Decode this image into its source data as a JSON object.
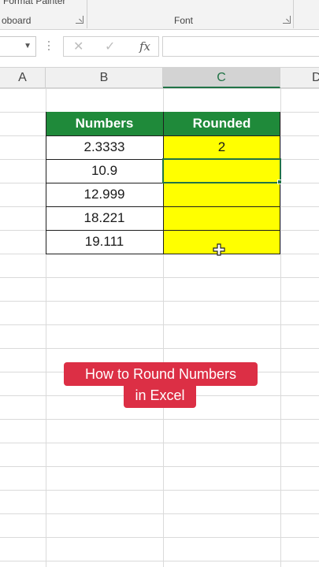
{
  "ribbon": {
    "clipboard_partial_label": "oboard",
    "format_painter_partial": "Format Painter",
    "font_group_label": "Font"
  },
  "formula_bar": {
    "cancel_symbol": "✕",
    "enter_symbol": "✓",
    "fx_label": "fx",
    "value": ""
  },
  "columns": [
    "A",
    "B",
    "C",
    "D"
  ],
  "selected_column": "C",
  "table": {
    "headers": [
      "Numbers",
      "Rounded"
    ],
    "numbers": [
      "2.3333",
      "10.9",
      "12.999",
      "18.221",
      "19.111"
    ],
    "rounded": [
      "2",
      "",
      "",
      "",
      ""
    ]
  },
  "caption": {
    "line1": "How to Round Numbers",
    "line2": "in Excel"
  },
  "colors": {
    "header_green": "#1f8a3a",
    "highlight_yellow": "#ffff00",
    "excel_green": "#217346",
    "caption_red": "#dc2f45"
  }
}
